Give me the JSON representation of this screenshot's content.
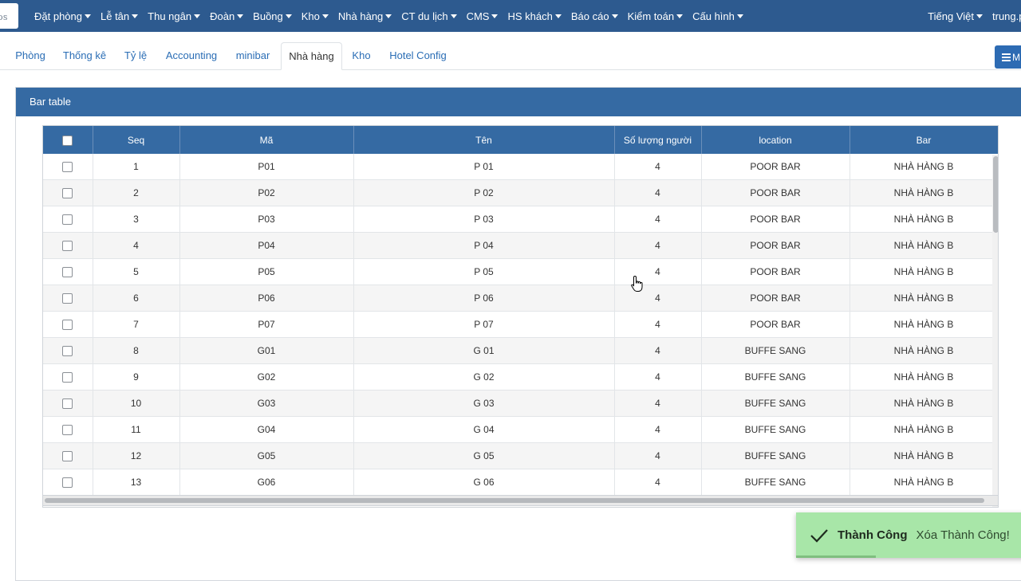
{
  "logo": {
    "text": "DS"
  },
  "topnav": {
    "items": [
      "Đặt phòng",
      "Lễ tân",
      "Thu ngân",
      "Đoàn",
      "Buồng",
      "Kho",
      "Nhà hàng",
      "CT du lịch",
      "CMS",
      "HS khách",
      "Báo cáo",
      "Kiểm toán",
      "Cấu hình"
    ],
    "language": "Tiếng Việt",
    "user": "trung.p"
  },
  "tabs": [
    "Phòng",
    "Thống kê",
    "Tỷ lệ",
    "Accounting",
    "minibar",
    "Nhà hàng",
    "Kho",
    "Hotel Config"
  ],
  "active_tab": "Nhà hàng",
  "menu_button": {
    "label": "M",
    "icon": "bars-icon"
  },
  "panel": {
    "title": "Bar table"
  },
  "table": {
    "columns": [
      "",
      "Seq",
      "Mã",
      "Tên",
      "Số lượng người",
      "location",
      "Bar"
    ],
    "rows": [
      {
        "seq": "1",
        "code": "P01",
        "name": "P 01",
        "people": "4",
        "location": "POOR BAR",
        "bar": "NHÀ HÀNG B"
      },
      {
        "seq": "2",
        "code": "P02",
        "name": "P 02",
        "people": "4",
        "location": "POOR BAR",
        "bar": "NHÀ HÀNG B"
      },
      {
        "seq": "3",
        "code": "P03",
        "name": "P 03",
        "people": "4",
        "location": "POOR BAR",
        "bar": "NHÀ HÀNG B"
      },
      {
        "seq": "4",
        "code": "P04",
        "name": "P 04",
        "people": "4",
        "location": "POOR BAR",
        "bar": "NHÀ HÀNG B"
      },
      {
        "seq": "5",
        "code": "P05",
        "name": "P 05",
        "people": "4",
        "location": "POOR BAR",
        "bar": "NHÀ HÀNG B"
      },
      {
        "seq": "6",
        "code": "P06",
        "name": "P 06",
        "people": "4",
        "location": "POOR BAR",
        "bar": "NHÀ HÀNG B"
      },
      {
        "seq": "7",
        "code": "P07",
        "name": "P 07",
        "people": "4",
        "location": "POOR BAR",
        "bar": "NHÀ HÀNG B"
      },
      {
        "seq": "8",
        "code": "G01",
        "name": "G 01",
        "people": "4",
        "location": "BUFFE SANG",
        "bar": "NHÀ HÀNG B"
      },
      {
        "seq": "9",
        "code": "G02",
        "name": "G 02",
        "people": "4",
        "location": "BUFFE SANG",
        "bar": "NHÀ HÀNG B"
      },
      {
        "seq": "10",
        "code": "G03",
        "name": "G 03",
        "people": "4",
        "location": "BUFFE SANG",
        "bar": "NHÀ HÀNG B"
      },
      {
        "seq": "11",
        "code": "G04",
        "name": "G 04",
        "people": "4",
        "location": "BUFFE SANG",
        "bar": "NHÀ HÀNG B"
      },
      {
        "seq": "12",
        "code": "G05",
        "name": "G 05",
        "people": "4",
        "location": "BUFFE SANG",
        "bar": "NHÀ HÀNG B"
      },
      {
        "seq": "13",
        "code": "G06",
        "name": "G 06",
        "people": "4",
        "location": "BUFFE SANG",
        "bar": "NHÀ HÀNG B"
      }
    ]
  },
  "toast": {
    "title": "Thành Công",
    "message": "Xóa Thành Công!",
    "icon": "check-icon"
  },
  "colors": {
    "nav": "#2d5a8f",
    "header": "#356aa3",
    "toast": "#a8e6a8",
    "link": "#2a6db5"
  }
}
